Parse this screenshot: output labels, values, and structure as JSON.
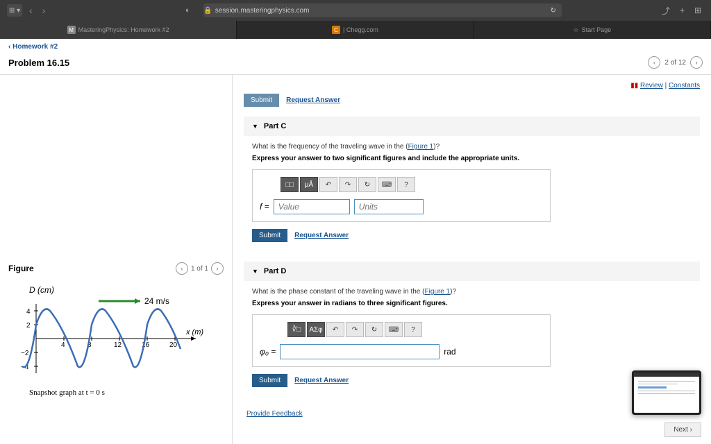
{
  "browser": {
    "url": "session.masteringphysics.com",
    "tabs": [
      {
        "icon": "M",
        "label": "MasteringPhysics: Homework #2"
      },
      {
        "icon": "C",
        "label": "| Chegg.com"
      },
      {
        "icon": "☆",
        "label": "Start Page"
      }
    ]
  },
  "breadcrumb": "‹ Homework #2",
  "problem_title": "Problem 16.15",
  "pager": {
    "pos": "2 of 12"
  },
  "top_links": {
    "review": "Review",
    "constants": "Constants",
    "sep": " | "
  },
  "prev_submit": {
    "submit": "Submit",
    "request": "Request Answer"
  },
  "partC": {
    "title": "Part C",
    "question_pre": "What is the frequency of the traveling wave in the (",
    "figure_link": "Figure 1",
    "question_post": ")?",
    "instruction": "Express your answer to two significant figures and include the appropriate units.",
    "var_label": "f = ",
    "value_ph": "Value",
    "units_ph": "Units",
    "submit": "Submit",
    "request": "Request Answer",
    "tools": {
      "t1": "□□",
      "t2": "μÅ",
      "undo": "↶",
      "redo": "↷",
      "reset": "↻",
      "kb": "⌨",
      "help": "?"
    }
  },
  "partD": {
    "title": "Part D",
    "question_pre": "What is the phase constant of the traveling wave in the (",
    "figure_link": "Figure 1",
    "question_post": ")?",
    "instruction": "Express your answer in radians to three significant figures.",
    "var_label": "φ₀ = ",
    "unit_label": "rad",
    "submit": "Submit",
    "request": "Request Answer",
    "tools": {
      "t1": "∛□",
      "t2": "ΑΣφ",
      "undo": "↶",
      "redo": "↷",
      "reset": "↻",
      "kb": "⌨",
      "help": "?"
    }
  },
  "figure": {
    "title": "Figure",
    "pager": "1 of 1",
    "y_label": "D (cm)",
    "x_label": "x (m)",
    "velocity": "24 m/s",
    "caption": "Snapshot graph at t = 0 s",
    "y_ticks": [
      "4",
      "2",
      "−2",
      "−4"
    ],
    "x_ticks": [
      "4",
      "8",
      "12",
      "16",
      "20"
    ]
  },
  "chart_data": {
    "type": "line",
    "title": "Snapshot graph at t = 0 s",
    "xlabel": "x (m)",
    "ylabel": "D (cm)",
    "xlim": [
      -2,
      22
    ],
    "ylim": [
      -5,
      5
    ],
    "x_ticks": [
      4,
      8,
      12,
      16,
      20
    ],
    "y_ticks": [
      -4,
      -2,
      2,
      4
    ],
    "annotation": {
      "text": "24 m/s",
      "arrow_from_x": 8,
      "arrow_to_x": 14,
      "y": 5
    },
    "series": [
      {
        "name": "D",
        "amplitude_cm": 4,
        "wavelength_m": 8,
        "phase_at_x0": "rising through ~2 cm",
        "points": [
          {
            "x": -2,
            "y": -4
          },
          {
            "x": 0,
            "y": 2
          },
          {
            "x": 2,
            "y": 4
          },
          {
            "x": 4,
            "y": 2
          },
          {
            "x": 6,
            "y": -4
          },
          {
            "x": 8,
            "y": 2
          },
          {
            "x": 10,
            "y": 4
          },
          {
            "x": 12,
            "y": 2
          },
          {
            "x": 14,
            "y": -4
          },
          {
            "x": 16,
            "y": 2
          },
          {
            "x": 18,
            "y": 4
          },
          {
            "x": 20,
            "y": 2
          }
        ]
      }
    ]
  },
  "feedback": "Provide Feedback",
  "next": "Next ›"
}
